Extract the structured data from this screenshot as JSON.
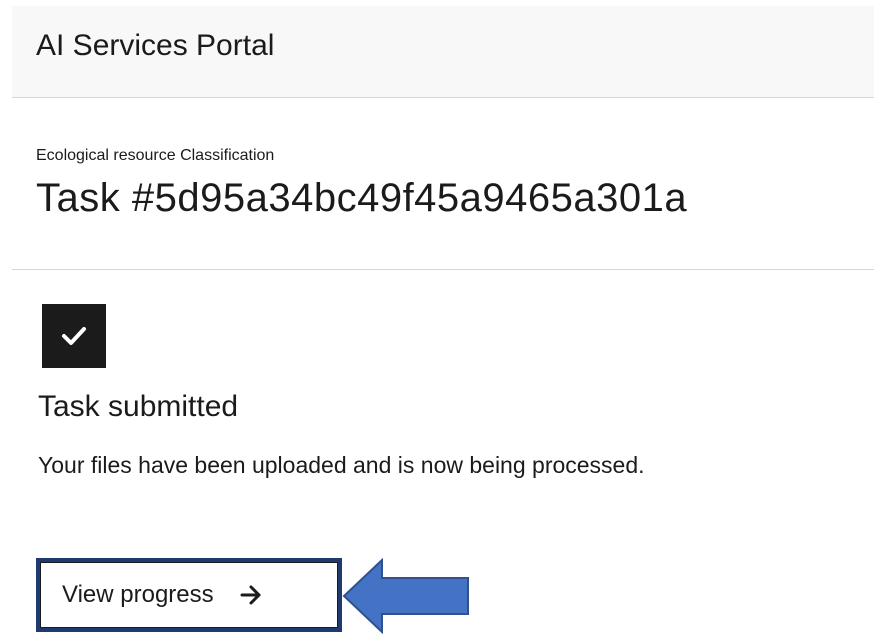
{
  "header": {
    "title": "AI Services Portal"
  },
  "task": {
    "subtitle": "Ecological resource Classification",
    "title": "Task #5d95a34bc49f45a9465a301a"
  },
  "status": {
    "icon": "checkmark-icon",
    "title": "Task submitted",
    "description": "Your files have been uploaded and is now being processed."
  },
  "actions": {
    "view_progress_label": "View progress",
    "view_progress_icon": "arrow-right-icon"
  },
  "annotation": {
    "icon": "left-pointing-arrow",
    "fill_color": "#4472c4",
    "stroke_color": "#2f528f"
  },
  "colors": {
    "button_border": "#1f3a6e",
    "check_background": "#1b1b1b",
    "header_background": "#f8f8f8"
  }
}
